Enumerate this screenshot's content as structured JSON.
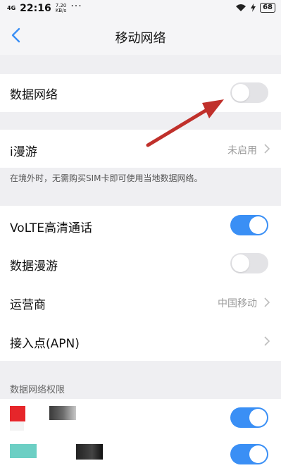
{
  "status_bar": {
    "network": "4G",
    "time": "22:16",
    "speed_value": "7.20",
    "speed_unit": "KB/s",
    "overflow": "···",
    "battery": "68"
  },
  "nav": {
    "title": "移动网络"
  },
  "rows": {
    "data_network": {
      "label": "数据网络",
      "toggle_on": false
    },
    "i_roaming": {
      "label": "i漫游",
      "value": "未启用"
    },
    "i_roaming_note": "在境外时，无需购买SIM卡即可使用当地数据网络。",
    "volte": {
      "label": "VoLTE高清通话",
      "toggle_on": true
    },
    "data_roaming": {
      "label": "数据漫游",
      "toggle_on": false
    },
    "carrier": {
      "label": "运营商",
      "value": "中国移动"
    },
    "apn": {
      "label": "接入点(APN)"
    }
  },
  "permissions": {
    "header": "数据网络权限",
    "apps": [
      {
        "toggle_on": true
      },
      {
        "toggle_on": true
      }
    ]
  },
  "colors": {
    "accent": "#3a8ff5",
    "annotation_arrow": "#c0302b",
    "background": "#efeff2"
  }
}
